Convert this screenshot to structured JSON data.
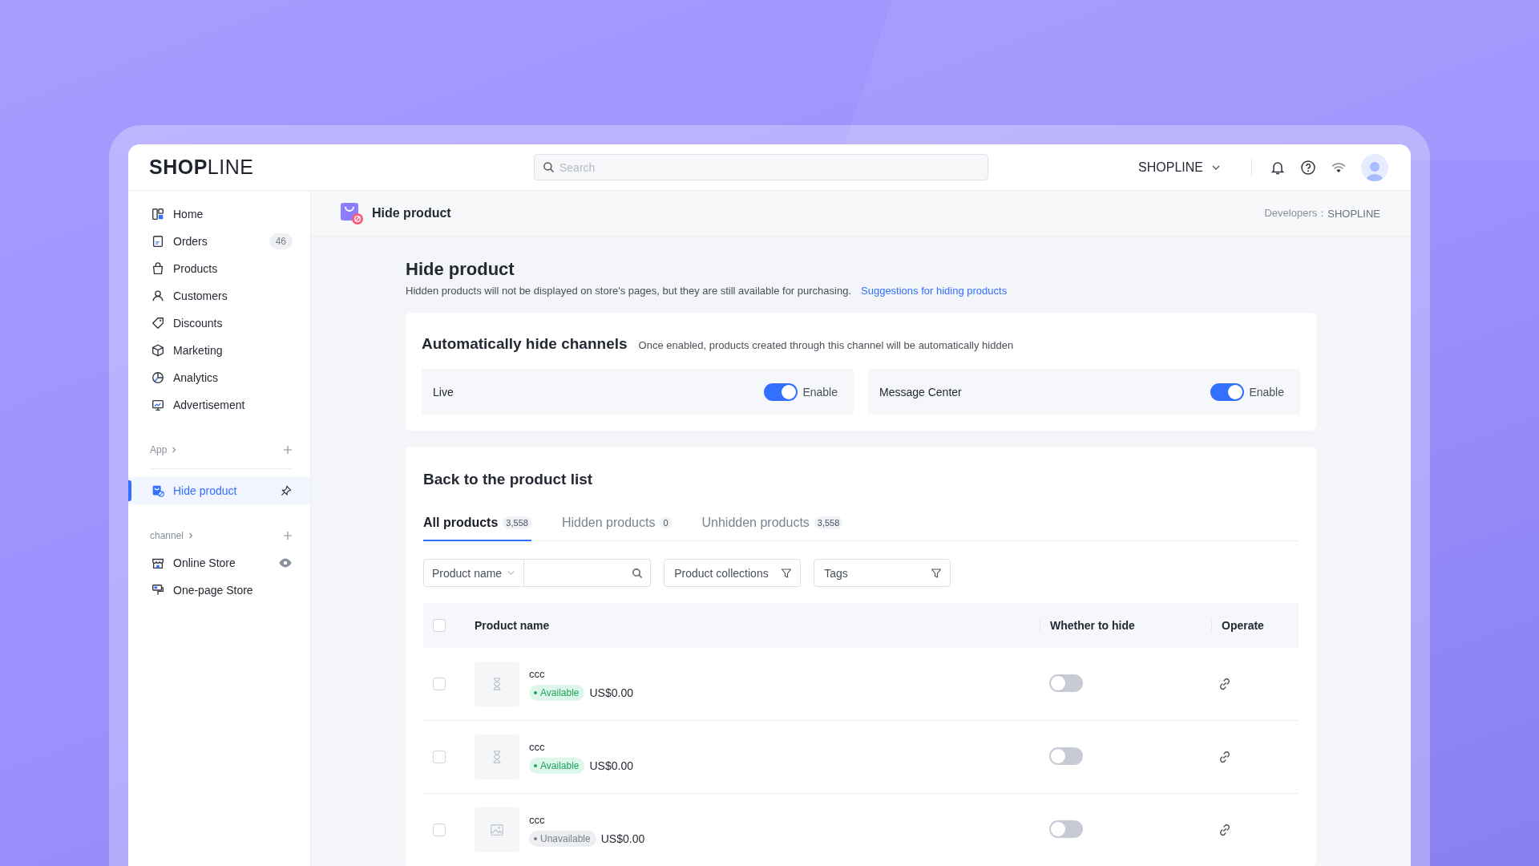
{
  "header": {
    "logo": "**SHOP**LINE",
    "search": {
      "placeholder": "Search"
    },
    "store": "SHOPLINE"
  },
  "sidebar": {
    "items": [
      {
        "label": "Home",
        "selected": false
      },
      {
        "label": "Orders",
        "badge": "46",
        "selected": false
      },
      {
        "label": "Products",
        "selected": false
      },
      {
        "label": "Customers",
        "selected": false
      },
      {
        "label": "Discounts",
        "selected": false
      },
      {
        "label": "Marketing",
        "selected": false
      },
      {
        "label": "Analytics",
        "selected": false
      },
      {
        "label": "Advertisement",
        "selected": false
      }
    ],
    "sections": [
      {
        "title": "App",
        "items": [
          {
            "label": "Hide product",
            "selected": true,
            "kind": "pinned"
          }
        ]
      },
      {
        "title": "channel",
        "items": [
          {
            "label": "Online Store",
            "selected": false,
            "kind": "visible"
          },
          {
            "label": "One-page Store",
            "selected": false,
            "kind": "plain"
          }
        ]
      }
    ]
  },
  "app_bar": {
    "title": "Hide product",
    "developer_label": "Developers：",
    "developer": "SHOPLINE"
  },
  "page": {
    "title": "Hide product",
    "description": "Hidden products will not be displayed on store's pages, but they are still available for purchasing.",
    "link": "Suggestions for hiding products"
  },
  "auto_hide": {
    "title": "Automatically hide channels",
    "hint": "Once enabled, products created through this channel will be automatically hidden",
    "channels": [
      {
        "name": "Live",
        "on": true,
        "toggle_label": "Enable"
      },
      {
        "name": "Message Center",
        "on": true,
        "toggle_label": "Enable"
      }
    ]
  },
  "products": {
    "title": "Back to the product list",
    "tabs": [
      {
        "label": "All products",
        "count": "3,558",
        "selected": true
      },
      {
        "label": "Hidden products",
        "count": "0",
        "selected": false
      },
      {
        "label": "Unhidden products",
        "count": "3,558",
        "selected": false
      }
    ],
    "filters": {
      "field_select": "Product name",
      "collections": "Product collections",
      "tags": "Tags"
    },
    "table": {
      "all_checked": false,
      "columns": [
        "Product name",
        "Whether to hide",
        "Operate"
      ],
      "rows": [
        {
          "name": "ccc",
          "status": "Available",
          "available": true,
          "price": "US$0.00",
          "hidden": false,
          "checked": false,
          "kind": "pending"
        },
        {
          "name": "ccc",
          "status": "Available",
          "available": true,
          "price": "US$0.00",
          "hidden": false,
          "checked": false,
          "kind": "pending"
        },
        {
          "name": "ccc",
          "status": "Unavailable",
          "available": false,
          "price": "US$0.00",
          "hidden": false,
          "checked": false,
          "kind": "image"
        }
      ]
    }
  }
}
